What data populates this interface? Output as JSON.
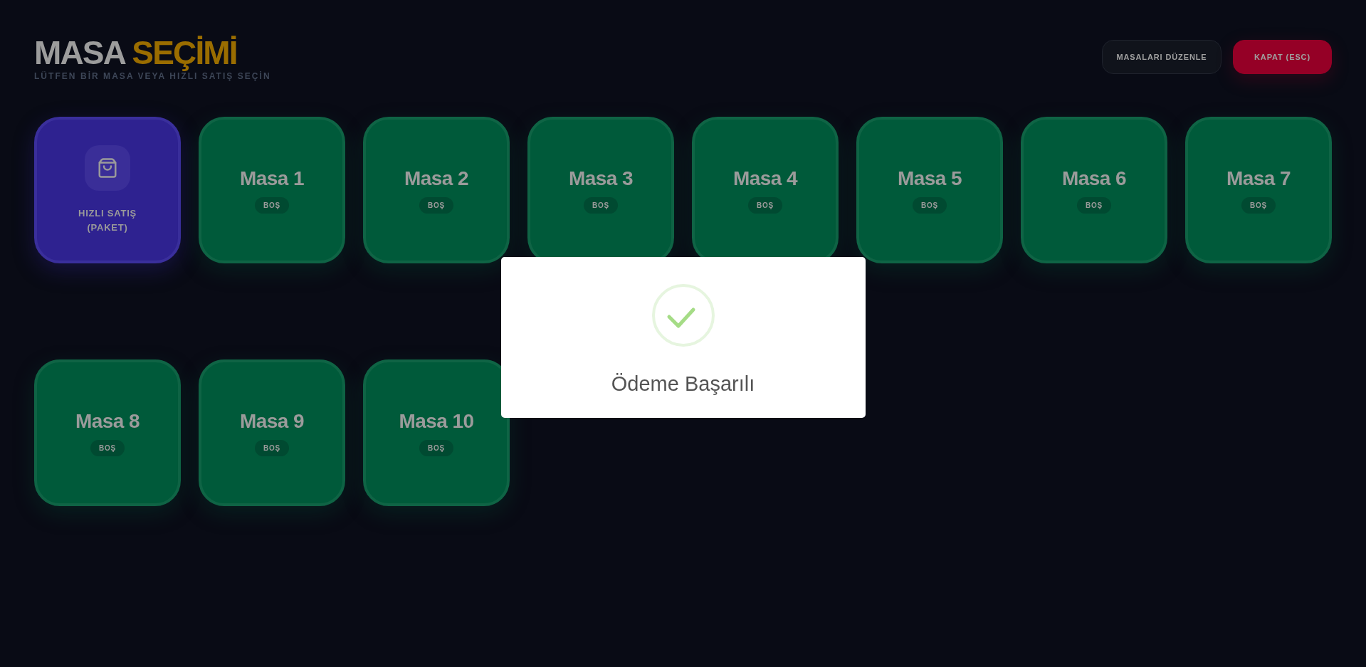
{
  "header": {
    "title": "MASA",
    "title_accent": "SEÇİMİ",
    "subtitle": "LÜTFEN BİR MASA VEYA HIZLI SATIŞ SEÇİN"
  },
  "buttons": [
    {
      "label": "MASALARI DÜZENLE",
      "kind": "secondary"
    },
    {
      "label": "KAPAT (ESC)",
      "kind": "danger"
    }
  ],
  "tiles": [
    {
      "kind": "quick_sale",
      "label": "HIZLI SATIŞ (PAKET)"
    },
    {
      "kind": "table",
      "label": "Masa 1",
      "status": "BOŞ"
    },
    {
      "kind": "table",
      "label": "Masa 2",
      "status": "BOŞ"
    },
    {
      "kind": "table",
      "label": "Masa 3",
      "status": "BOŞ"
    },
    {
      "kind": "table",
      "label": "Masa 4",
      "status": "BOŞ"
    },
    {
      "kind": "table",
      "label": "Masa 5",
      "status": "BOŞ"
    },
    {
      "kind": "table",
      "label": "Masa 6",
      "status": "BOŞ"
    },
    {
      "kind": "table",
      "label": "Masa 7",
      "status": "BOŞ"
    },
    {
      "kind": "table",
      "label": "Masa 8",
      "status": "BOŞ"
    },
    {
      "kind": "table",
      "label": "Masa 9",
      "status": "BOŞ"
    },
    {
      "kind": "table",
      "label": "Masa 10",
      "status": "BOŞ"
    }
  ],
  "dialog": {
    "title": "Ödeme Başarılı"
  }
}
